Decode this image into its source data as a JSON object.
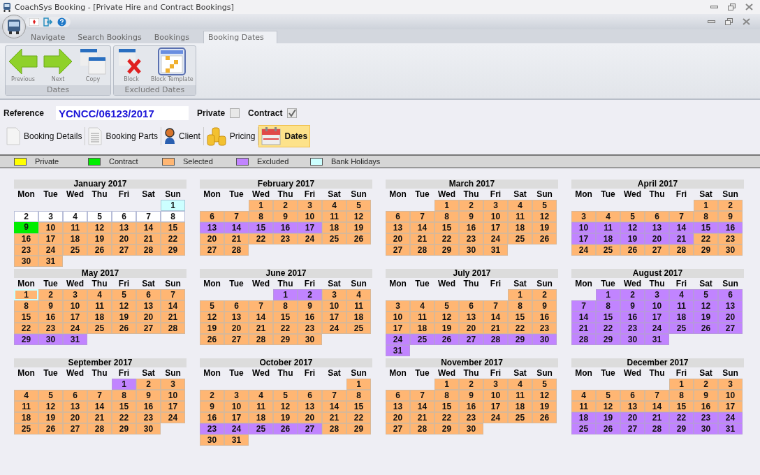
{
  "window": {
    "title": "CoachSys Booking - [Private Hire and Contract Bookings]"
  },
  "ribbon_tabs": [
    {
      "label": "Navigate",
      "selected": false
    },
    {
      "label": "Search Bookings",
      "selected": false
    },
    {
      "label": "Bookings",
      "selected": false
    },
    {
      "label": "Booking Dates",
      "selected": true
    }
  ],
  "ribbon_groups": [
    {
      "title": "Dates",
      "buttons": [
        {
          "label": "Previous",
          "kind": "previous"
        },
        {
          "label": "Next",
          "kind": "next"
        },
        {
          "label": "Copy",
          "kind": "copy"
        }
      ]
    },
    {
      "title": "Excluded Dates",
      "buttons": [
        {
          "label": "Block",
          "kind": "block"
        },
        {
          "label": "Block Template",
          "kind": "template"
        }
      ]
    }
  ],
  "reference": {
    "label": "Reference",
    "value": "YCNCC/06123/2017"
  },
  "flags": [
    {
      "label": "Private",
      "checked": false
    },
    {
      "label": "Contract",
      "checked": true
    }
  ],
  "sections": [
    {
      "label": "Booking Details",
      "kind": "document",
      "selected": false
    },
    {
      "label": "Booking Parts",
      "kind": "list",
      "selected": false
    },
    {
      "label": "Client",
      "kind": "person",
      "selected": false
    },
    {
      "label": "Pricing",
      "kind": "coins",
      "selected": false
    },
    {
      "label": "Dates",
      "kind": "calendar",
      "selected": true
    }
  ],
  "legend": [
    {
      "label": "Private",
      "color": "#ffff00"
    },
    {
      "label": "Contract",
      "color": "#00ee00"
    },
    {
      "label": "Selected",
      "color": "#ffb673"
    },
    {
      "label": "Excluded",
      "color": "#c184ff"
    },
    {
      "label": "Bank Holidays",
      "color": "#ccffff"
    }
  ],
  "months": [
    {
      "title": "January 2017",
      "weekdays": [
        "Mon",
        "Tue",
        "Wed",
        "Thu",
        "Fri",
        "Sat",
        "Sun"
      ],
      "weeks": [
        [
          {
            "kind": "blank"
          },
          {
            "kind": "blank"
          },
          {
            "kind": "blank"
          },
          {
            "kind": "blank"
          },
          {
            "kind": "blank"
          },
          {
            "kind": "blank"
          },
          {
            "day": "1",
            "kind": "holiday"
          }
        ],
        [
          {
            "day": "2",
            "kind": "open"
          },
          {
            "day": "3",
            "kind": "open"
          },
          {
            "day": "4",
            "kind": "open"
          },
          {
            "day": "5",
            "kind": "open"
          },
          {
            "day": "6",
            "kind": "open"
          },
          {
            "day": "7",
            "kind": "open"
          },
          {
            "day": "8",
            "kind": "open"
          }
        ],
        [
          {
            "day": "9",
            "kind": "contract"
          },
          {
            "day": "10",
            "kind": "selected"
          },
          {
            "day": "11",
            "kind": "selected"
          },
          {
            "day": "12",
            "kind": "selected"
          },
          {
            "day": "13",
            "kind": "selected"
          },
          {
            "day": "14",
            "kind": "selected"
          },
          {
            "day": "15",
            "kind": "selected"
          }
        ],
        [
          {
            "day": "16",
            "kind": "selected"
          },
          {
            "day": "17",
            "kind": "selected"
          },
          {
            "day": "18",
            "kind": "selected"
          },
          {
            "day": "19",
            "kind": "selected"
          },
          {
            "day": "20",
            "kind": "selected"
          },
          {
            "day": "21",
            "kind": "selected"
          },
          {
            "day": "22",
            "kind": "selected"
          }
        ],
        [
          {
            "day": "23",
            "kind": "selected"
          },
          {
            "day": "24",
            "kind": "selected"
          },
          {
            "day": "25",
            "kind": "selected"
          },
          {
            "day": "26",
            "kind": "selected"
          },
          {
            "day": "27",
            "kind": "selected"
          },
          {
            "day": "28",
            "kind": "selected"
          },
          {
            "day": "29",
            "kind": "selected"
          }
        ],
        [
          {
            "day": "30",
            "kind": "selected"
          },
          {
            "day": "31",
            "kind": "selected"
          }
        ]
      ]
    },
    {
      "title": "February 2017",
      "weekdays": [
        "Mon",
        "Tue",
        "Wed",
        "Thu",
        "Fri",
        "Sat",
        "Sun"
      ],
      "weeks": [
        [
          {
            "kind": "blank"
          },
          {
            "kind": "blank"
          },
          {
            "day": "1",
            "kind": "selected"
          },
          {
            "day": "2",
            "kind": "selected"
          },
          {
            "day": "3",
            "kind": "selected"
          },
          {
            "day": "4",
            "kind": "selected"
          },
          {
            "day": "5",
            "kind": "selected"
          }
        ],
        [
          {
            "day": "6",
            "kind": "selected"
          },
          {
            "day": "7",
            "kind": "selected"
          },
          {
            "day": "8",
            "kind": "selected"
          },
          {
            "day": "9",
            "kind": "selected"
          },
          {
            "day": "10",
            "kind": "selected"
          },
          {
            "day": "11",
            "kind": "selected"
          },
          {
            "day": "12",
            "kind": "selected"
          }
        ],
        [
          {
            "day": "13",
            "kind": "excluded"
          },
          {
            "day": "14",
            "kind": "excluded"
          },
          {
            "day": "15",
            "kind": "excluded"
          },
          {
            "day": "16",
            "kind": "excluded"
          },
          {
            "day": "17",
            "kind": "excluded"
          },
          {
            "day": "18",
            "kind": "selected"
          },
          {
            "day": "19",
            "kind": "selected"
          }
        ],
        [
          {
            "day": "20",
            "kind": "selected"
          },
          {
            "day": "21",
            "kind": "selected"
          },
          {
            "day": "22",
            "kind": "selected"
          },
          {
            "day": "23",
            "kind": "selected"
          },
          {
            "day": "24",
            "kind": "selected"
          },
          {
            "day": "25",
            "kind": "selected"
          },
          {
            "day": "26",
            "kind": "selected"
          }
        ],
        [
          {
            "day": "27",
            "kind": "selected"
          },
          {
            "day": "28",
            "kind": "selected"
          }
        ]
      ]
    },
    {
      "title": "March 2017",
      "weekdays": [
        "Mon",
        "Tue",
        "Wed",
        "Thu",
        "Fri",
        "Sat",
        "Sun"
      ],
      "weeks": [
        [
          {
            "kind": "blank"
          },
          {
            "kind": "blank"
          },
          {
            "day": "1",
            "kind": "selected"
          },
          {
            "day": "2",
            "kind": "selected"
          },
          {
            "day": "3",
            "kind": "selected"
          },
          {
            "day": "4",
            "kind": "selected"
          },
          {
            "day": "5",
            "kind": "selected"
          }
        ],
        [
          {
            "day": "6",
            "kind": "selected"
          },
          {
            "day": "7",
            "kind": "selected"
          },
          {
            "day": "8",
            "kind": "selected"
          },
          {
            "day": "9",
            "kind": "selected"
          },
          {
            "day": "10",
            "kind": "selected"
          },
          {
            "day": "11",
            "kind": "selected"
          },
          {
            "day": "12",
            "kind": "selected"
          }
        ],
        [
          {
            "day": "13",
            "kind": "selected"
          },
          {
            "day": "14",
            "kind": "selected"
          },
          {
            "day": "15",
            "kind": "selected"
          },
          {
            "day": "16",
            "kind": "selected"
          },
          {
            "day": "17",
            "kind": "selected"
          },
          {
            "day": "18",
            "kind": "selected"
          },
          {
            "day": "19",
            "kind": "selected"
          }
        ],
        [
          {
            "day": "20",
            "kind": "selected"
          },
          {
            "day": "21",
            "kind": "selected"
          },
          {
            "day": "22",
            "kind": "selected"
          },
          {
            "day": "23",
            "kind": "selected"
          },
          {
            "day": "24",
            "kind": "selected"
          },
          {
            "day": "25",
            "kind": "selected"
          },
          {
            "day": "26",
            "kind": "selected"
          }
        ],
        [
          {
            "day": "27",
            "kind": "selected"
          },
          {
            "day": "28",
            "kind": "selected"
          },
          {
            "day": "29",
            "kind": "selected"
          },
          {
            "day": "30",
            "kind": "selected"
          },
          {
            "day": "31",
            "kind": "selected"
          }
        ]
      ]
    },
    {
      "title": "April 2017",
      "weekdays": [
        "Mon",
        "Tue",
        "Wed",
        "Thu",
        "Fri",
        "Sat",
        "Sun"
      ],
      "weeks": [
        [
          {
            "kind": "blank"
          },
          {
            "kind": "blank"
          },
          {
            "kind": "blank"
          },
          {
            "kind": "blank"
          },
          {
            "kind": "blank"
          },
          {
            "day": "1",
            "kind": "selected"
          },
          {
            "day": "2",
            "kind": "selected"
          }
        ],
        [
          {
            "day": "3",
            "kind": "selected"
          },
          {
            "day": "4",
            "kind": "selected"
          },
          {
            "day": "5",
            "kind": "selected"
          },
          {
            "day": "6",
            "kind": "selected"
          },
          {
            "day": "7",
            "kind": "selected"
          },
          {
            "day": "8",
            "kind": "selected"
          },
          {
            "day": "9",
            "kind": "selected"
          }
        ],
        [
          {
            "day": "10",
            "kind": "excluded"
          },
          {
            "day": "11",
            "kind": "excluded"
          },
          {
            "day": "12",
            "kind": "excluded"
          },
          {
            "day": "13",
            "kind": "excluded"
          },
          {
            "day": "14",
            "kind": "excluded"
          },
          {
            "day": "15",
            "kind": "excluded"
          },
          {
            "day": "16",
            "kind": "excluded"
          }
        ],
        [
          {
            "day": "17",
            "kind": "excluded"
          },
          {
            "day": "18",
            "kind": "excluded"
          },
          {
            "day": "19",
            "kind": "excluded"
          },
          {
            "day": "20",
            "kind": "excluded"
          },
          {
            "day": "21",
            "kind": "excluded"
          },
          {
            "day": "22",
            "kind": "selected"
          },
          {
            "day": "23",
            "kind": "selected"
          }
        ],
        [
          {
            "day": "24",
            "kind": "selected"
          },
          {
            "day": "25",
            "kind": "selected"
          },
          {
            "day": "26",
            "kind": "selected"
          },
          {
            "day": "27",
            "kind": "selected"
          },
          {
            "day": "28",
            "kind": "selected"
          },
          {
            "day": "29",
            "kind": "selected"
          },
          {
            "day": "30",
            "kind": "selected"
          }
        ]
      ]
    },
    {
      "title": "May 2017",
      "weekdays": [
        "Mon",
        "Tue",
        "Wed",
        "Thu",
        "Fri",
        "Sat",
        "Sun"
      ],
      "weeks": [
        [
          {
            "day": "1",
            "kind": "holiday-selected"
          },
          {
            "day": "2",
            "kind": "selected"
          },
          {
            "day": "3",
            "kind": "selected"
          },
          {
            "day": "4",
            "kind": "selected"
          },
          {
            "day": "5",
            "kind": "selected"
          },
          {
            "day": "6",
            "kind": "selected"
          },
          {
            "day": "7",
            "kind": "selected"
          }
        ],
        [
          {
            "day": "8",
            "kind": "selected"
          },
          {
            "day": "9",
            "kind": "selected"
          },
          {
            "day": "10",
            "kind": "selected"
          },
          {
            "day": "11",
            "kind": "selected"
          },
          {
            "day": "12",
            "kind": "selected"
          },
          {
            "day": "13",
            "kind": "selected"
          },
          {
            "day": "14",
            "kind": "selected"
          }
        ],
        [
          {
            "day": "15",
            "kind": "selected"
          },
          {
            "day": "16",
            "kind": "selected"
          },
          {
            "day": "17",
            "kind": "selected"
          },
          {
            "day": "18",
            "kind": "selected"
          },
          {
            "day": "19",
            "kind": "selected"
          },
          {
            "day": "20",
            "kind": "selected"
          },
          {
            "day": "21",
            "kind": "selected"
          }
        ],
        [
          {
            "day": "22",
            "kind": "selected"
          },
          {
            "day": "23",
            "kind": "selected"
          },
          {
            "day": "24",
            "kind": "selected"
          },
          {
            "day": "25",
            "kind": "selected"
          },
          {
            "day": "26",
            "kind": "selected"
          },
          {
            "day": "27",
            "kind": "selected"
          },
          {
            "day": "28",
            "kind": "selected"
          }
        ],
        [
          {
            "day": "29",
            "kind": "excluded"
          },
          {
            "day": "30",
            "kind": "excluded"
          },
          {
            "day": "31",
            "kind": "excluded"
          }
        ]
      ]
    },
    {
      "title": "June 2017",
      "weekdays": [
        "Mon",
        "Tue",
        "Wed",
        "Thu",
        "Fri",
        "Sat",
        "Sun"
      ],
      "weeks": [
        [
          {
            "kind": "blank"
          },
          {
            "kind": "blank"
          },
          {
            "kind": "blank"
          },
          {
            "day": "1",
            "kind": "excluded"
          },
          {
            "day": "2",
            "kind": "excluded"
          },
          {
            "day": "3",
            "kind": "selected"
          },
          {
            "day": "4",
            "kind": "selected"
          }
        ],
        [
          {
            "day": "5",
            "kind": "selected"
          },
          {
            "day": "6",
            "kind": "selected"
          },
          {
            "day": "7",
            "kind": "selected"
          },
          {
            "day": "8",
            "kind": "selected"
          },
          {
            "day": "9",
            "kind": "selected"
          },
          {
            "day": "10",
            "kind": "selected"
          },
          {
            "day": "11",
            "kind": "selected"
          }
        ],
        [
          {
            "day": "12",
            "kind": "selected"
          },
          {
            "day": "13",
            "kind": "selected"
          },
          {
            "day": "14",
            "kind": "selected"
          },
          {
            "day": "15",
            "kind": "selected"
          },
          {
            "day": "16",
            "kind": "selected"
          },
          {
            "day": "17",
            "kind": "selected"
          },
          {
            "day": "18",
            "kind": "selected"
          }
        ],
        [
          {
            "day": "19",
            "kind": "selected"
          },
          {
            "day": "20",
            "kind": "selected"
          },
          {
            "day": "21",
            "kind": "selected"
          },
          {
            "day": "22",
            "kind": "selected"
          },
          {
            "day": "23",
            "kind": "selected"
          },
          {
            "day": "24",
            "kind": "selected"
          },
          {
            "day": "25",
            "kind": "selected"
          }
        ],
        [
          {
            "day": "26",
            "kind": "selected"
          },
          {
            "day": "27",
            "kind": "selected"
          },
          {
            "day": "28",
            "kind": "selected"
          },
          {
            "day": "29",
            "kind": "selected"
          },
          {
            "day": "30",
            "kind": "selected"
          }
        ]
      ]
    },
    {
      "title": "July 2017",
      "weekdays": [
        "Mon",
        "Tue",
        "Wed",
        "Thu",
        "Fri",
        "Sat",
        "Sun"
      ],
      "weeks": [
        [
          {
            "kind": "blank"
          },
          {
            "kind": "blank"
          },
          {
            "kind": "blank"
          },
          {
            "kind": "blank"
          },
          {
            "kind": "blank"
          },
          {
            "day": "1",
            "kind": "selected"
          },
          {
            "day": "2",
            "kind": "selected"
          }
        ],
        [
          {
            "day": "3",
            "kind": "selected"
          },
          {
            "day": "4",
            "kind": "selected"
          },
          {
            "day": "5",
            "kind": "selected"
          },
          {
            "day": "6",
            "kind": "selected"
          },
          {
            "day": "7",
            "kind": "selected"
          },
          {
            "day": "8",
            "kind": "selected"
          },
          {
            "day": "9",
            "kind": "selected"
          }
        ],
        [
          {
            "day": "10",
            "kind": "selected"
          },
          {
            "day": "11",
            "kind": "selected"
          },
          {
            "day": "12",
            "kind": "selected"
          },
          {
            "day": "13",
            "kind": "selected"
          },
          {
            "day": "14",
            "kind": "selected"
          },
          {
            "day": "15",
            "kind": "selected"
          },
          {
            "day": "16",
            "kind": "selected"
          }
        ],
        [
          {
            "day": "17",
            "kind": "selected"
          },
          {
            "day": "18",
            "kind": "selected"
          },
          {
            "day": "19",
            "kind": "selected"
          },
          {
            "day": "20",
            "kind": "selected"
          },
          {
            "day": "21",
            "kind": "selected"
          },
          {
            "day": "22",
            "kind": "selected"
          },
          {
            "day": "23",
            "kind": "selected"
          }
        ],
        [
          {
            "day": "24",
            "kind": "excluded"
          },
          {
            "day": "25",
            "kind": "excluded"
          },
          {
            "day": "26",
            "kind": "excluded"
          },
          {
            "day": "27",
            "kind": "excluded"
          },
          {
            "day": "28",
            "kind": "excluded"
          },
          {
            "day": "29",
            "kind": "excluded"
          },
          {
            "day": "30",
            "kind": "excluded"
          }
        ],
        [
          {
            "day": "31",
            "kind": "excluded"
          }
        ]
      ]
    },
    {
      "title": "August 2017",
      "weekdays": [
        "Mon",
        "Tue",
        "Wed",
        "Thu",
        "Fri",
        "Sat",
        "Sun"
      ],
      "weeks": [
        [
          {
            "kind": "blank"
          },
          {
            "day": "1",
            "kind": "excluded"
          },
          {
            "day": "2",
            "kind": "excluded"
          },
          {
            "day": "3",
            "kind": "excluded"
          },
          {
            "day": "4",
            "kind": "excluded"
          },
          {
            "day": "5",
            "kind": "excluded"
          },
          {
            "day": "6",
            "kind": "excluded"
          }
        ],
        [
          {
            "day": "7",
            "kind": "excluded"
          },
          {
            "day": "8",
            "kind": "excluded"
          },
          {
            "day": "9",
            "kind": "excluded"
          },
          {
            "day": "10",
            "kind": "excluded"
          },
          {
            "day": "11",
            "kind": "excluded"
          },
          {
            "day": "12",
            "kind": "excluded"
          },
          {
            "day": "13",
            "kind": "excluded"
          }
        ],
        [
          {
            "day": "14",
            "kind": "excluded"
          },
          {
            "day": "15",
            "kind": "excluded"
          },
          {
            "day": "16",
            "kind": "excluded"
          },
          {
            "day": "17",
            "kind": "excluded"
          },
          {
            "day": "18",
            "kind": "excluded"
          },
          {
            "day": "19",
            "kind": "excluded"
          },
          {
            "day": "20",
            "kind": "excluded"
          }
        ],
        [
          {
            "day": "21",
            "kind": "excluded"
          },
          {
            "day": "22",
            "kind": "excluded"
          },
          {
            "day": "23",
            "kind": "excluded"
          },
          {
            "day": "24",
            "kind": "excluded"
          },
          {
            "day": "25",
            "kind": "excluded"
          },
          {
            "day": "26",
            "kind": "excluded"
          },
          {
            "day": "27",
            "kind": "excluded"
          }
        ],
        [
          {
            "day": "28",
            "kind": "excluded"
          },
          {
            "day": "29",
            "kind": "excluded"
          },
          {
            "day": "30",
            "kind": "excluded"
          },
          {
            "day": "31",
            "kind": "excluded"
          }
        ]
      ]
    },
    {
      "title": "September 2017",
      "weekdays": [
        "Mon",
        "Tue",
        "Wed",
        "Thu",
        "Fri",
        "Sat",
        "Sun"
      ],
      "weeks": [
        [
          {
            "kind": "blank"
          },
          {
            "kind": "blank"
          },
          {
            "kind": "blank"
          },
          {
            "kind": "blank"
          },
          {
            "day": "1",
            "kind": "excluded"
          },
          {
            "day": "2",
            "kind": "selected"
          },
          {
            "day": "3",
            "kind": "selected"
          }
        ],
        [
          {
            "day": "4",
            "kind": "selected"
          },
          {
            "day": "5",
            "kind": "selected"
          },
          {
            "day": "6",
            "kind": "selected"
          },
          {
            "day": "7",
            "kind": "selected"
          },
          {
            "day": "8",
            "kind": "selected"
          },
          {
            "day": "9",
            "kind": "selected"
          },
          {
            "day": "10",
            "kind": "selected"
          }
        ],
        [
          {
            "day": "11",
            "kind": "selected"
          },
          {
            "day": "12",
            "kind": "selected"
          },
          {
            "day": "13",
            "kind": "selected"
          },
          {
            "day": "14",
            "kind": "selected"
          },
          {
            "day": "15",
            "kind": "selected"
          },
          {
            "day": "16",
            "kind": "selected"
          },
          {
            "day": "17",
            "kind": "selected"
          }
        ],
        [
          {
            "day": "18",
            "kind": "selected"
          },
          {
            "day": "19",
            "kind": "selected"
          },
          {
            "day": "20",
            "kind": "selected"
          },
          {
            "day": "21",
            "kind": "selected"
          },
          {
            "day": "22",
            "kind": "selected"
          },
          {
            "day": "23",
            "kind": "selected"
          },
          {
            "day": "24",
            "kind": "selected"
          }
        ],
        [
          {
            "day": "25",
            "kind": "selected"
          },
          {
            "day": "26",
            "kind": "selected"
          },
          {
            "day": "27",
            "kind": "selected"
          },
          {
            "day": "28",
            "kind": "selected"
          },
          {
            "day": "29",
            "kind": "selected"
          },
          {
            "day": "30",
            "kind": "selected"
          }
        ]
      ]
    },
    {
      "title": "October 2017",
      "weekdays": [
        "Mon",
        "Tue",
        "Wed",
        "Thu",
        "Fri",
        "Sat",
        "Sun"
      ],
      "weeks": [
        [
          {
            "kind": "blank"
          },
          {
            "kind": "blank"
          },
          {
            "kind": "blank"
          },
          {
            "kind": "blank"
          },
          {
            "kind": "blank"
          },
          {
            "kind": "blank"
          },
          {
            "day": "1",
            "kind": "selected"
          }
        ],
        [
          {
            "day": "2",
            "kind": "selected"
          },
          {
            "day": "3",
            "kind": "selected"
          },
          {
            "day": "4",
            "kind": "selected"
          },
          {
            "day": "5",
            "kind": "selected"
          },
          {
            "day": "6",
            "kind": "selected"
          },
          {
            "day": "7",
            "kind": "selected"
          },
          {
            "day": "8",
            "kind": "selected"
          }
        ],
        [
          {
            "day": "9",
            "kind": "selected"
          },
          {
            "day": "10",
            "kind": "selected"
          },
          {
            "day": "11",
            "kind": "selected"
          },
          {
            "day": "12",
            "kind": "selected"
          },
          {
            "day": "13",
            "kind": "selected"
          },
          {
            "day": "14",
            "kind": "selected"
          },
          {
            "day": "15",
            "kind": "selected"
          }
        ],
        [
          {
            "day": "16",
            "kind": "selected"
          },
          {
            "day": "17",
            "kind": "selected"
          },
          {
            "day": "18",
            "kind": "selected"
          },
          {
            "day": "19",
            "kind": "selected"
          },
          {
            "day": "20",
            "kind": "selected"
          },
          {
            "day": "21",
            "kind": "selected"
          },
          {
            "day": "22",
            "kind": "selected"
          }
        ],
        [
          {
            "day": "23",
            "kind": "excluded"
          },
          {
            "day": "24",
            "kind": "excluded"
          },
          {
            "day": "25",
            "kind": "excluded"
          },
          {
            "day": "26",
            "kind": "excluded"
          },
          {
            "day": "27",
            "kind": "excluded"
          },
          {
            "day": "28",
            "kind": "selected"
          },
          {
            "day": "29",
            "kind": "selected"
          }
        ],
        [
          {
            "day": "30",
            "kind": "selected"
          },
          {
            "day": "31",
            "kind": "selected"
          }
        ]
      ]
    },
    {
      "title": "November 2017",
      "weekdays": [
        "Mon",
        "Tue",
        "Wed",
        "Thu",
        "Fri",
        "Sat",
        "Sun"
      ],
      "weeks": [
        [
          {
            "kind": "blank"
          },
          {
            "kind": "blank"
          },
          {
            "day": "1",
            "kind": "selected"
          },
          {
            "day": "2",
            "kind": "selected"
          },
          {
            "day": "3",
            "kind": "selected"
          },
          {
            "day": "4",
            "kind": "selected"
          },
          {
            "day": "5",
            "kind": "selected"
          }
        ],
        [
          {
            "day": "6",
            "kind": "selected"
          },
          {
            "day": "7",
            "kind": "selected"
          },
          {
            "day": "8",
            "kind": "selected"
          },
          {
            "day": "9",
            "kind": "selected"
          },
          {
            "day": "10",
            "kind": "selected"
          },
          {
            "day": "11",
            "kind": "selected"
          },
          {
            "day": "12",
            "kind": "selected"
          }
        ],
        [
          {
            "day": "13",
            "kind": "selected"
          },
          {
            "day": "14",
            "kind": "selected"
          },
          {
            "day": "15",
            "kind": "selected"
          },
          {
            "day": "16",
            "kind": "selected"
          },
          {
            "day": "17",
            "kind": "selected"
          },
          {
            "day": "18",
            "kind": "selected"
          },
          {
            "day": "19",
            "kind": "selected"
          }
        ],
        [
          {
            "day": "20",
            "kind": "selected"
          },
          {
            "day": "21",
            "kind": "selected"
          },
          {
            "day": "22",
            "kind": "selected"
          },
          {
            "day": "23",
            "kind": "selected"
          },
          {
            "day": "24",
            "kind": "selected"
          },
          {
            "day": "25",
            "kind": "selected"
          },
          {
            "day": "26",
            "kind": "selected"
          }
        ],
        [
          {
            "day": "27",
            "kind": "selected"
          },
          {
            "day": "28",
            "kind": "selected"
          },
          {
            "day": "29",
            "kind": "selected"
          },
          {
            "day": "30",
            "kind": "selected"
          }
        ]
      ]
    },
    {
      "title": "December 2017",
      "weekdays": [
        "Mon",
        "Tue",
        "Wed",
        "Thu",
        "Fri",
        "Sat",
        "Sun"
      ],
      "weeks": [
        [
          {
            "kind": "blank"
          },
          {
            "kind": "blank"
          },
          {
            "kind": "blank"
          },
          {
            "kind": "blank"
          },
          {
            "day": "1",
            "kind": "selected"
          },
          {
            "day": "2",
            "kind": "selected"
          },
          {
            "day": "3",
            "kind": "selected"
          }
        ],
        [
          {
            "day": "4",
            "kind": "selected"
          },
          {
            "day": "5",
            "kind": "selected"
          },
          {
            "day": "6",
            "kind": "selected"
          },
          {
            "day": "7",
            "kind": "selected"
          },
          {
            "day": "8",
            "kind": "selected"
          },
          {
            "day": "9",
            "kind": "selected"
          },
          {
            "day": "10",
            "kind": "selected"
          }
        ],
        [
          {
            "day": "11",
            "kind": "selected"
          },
          {
            "day": "12",
            "kind": "selected"
          },
          {
            "day": "13",
            "kind": "selected"
          },
          {
            "day": "14",
            "kind": "selected"
          },
          {
            "day": "15",
            "kind": "selected"
          },
          {
            "day": "16",
            "kind": "selected"
          },
          {
            "day": "17",
            "kind": "selected"
          }
        ],
        [
          {
            "day": "18",
            "kind": "excluded"
          },
          {
            "day": "19",
            "kind": "excluded"
          },
          {
            "day": "20",
            "kind": "excluded"
          },
          {
            "day": "21",
            "kind": "excluded"
          },
          {
            "day": "22",
            "kind": "excluded"
          },
          {
            "day": "23",
            "kind": "excluded"
          },
          {
            "day": "24",
            "kind": "excluded"
          }
        ],
        [
          {
            "day": "25",
            "kind": "excluded"
          },
          {
            "day": "26",
            "kind": "excluded"
          },
          {
            "day": "27",
            "kind": "excluded"
          },
          {
            "day": "28",
            "kind": "excluded"
          },
          {
            "day": "29",
            "kind": "excluded"
          },
          {
            "day": "30",
            "kind": "excluded"
          },
          {
            "day": "31",
            "kind": "excluded"
          }
        ]
      ]
    }
  ]
}
